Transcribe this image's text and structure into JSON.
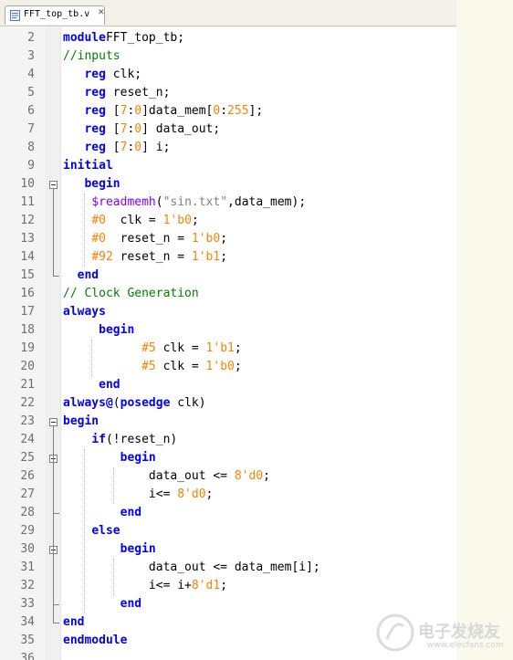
{
  "tab": {
    "filename": "FFT_top_tb.v",
    "close_label": "✕",
    "icon": "verilog-file-icon"
  },
  "colors": {
    "keyword": "#0000ff",
    "comment": "#008000",
    "number": "#ff8000",
    "system_task": "#8000ff",
    "string": "#808080",
    "line_number": "#6f6f6f"
  },
  "lines": [
    {
      "num": "2",
      "tokens": [
        [
          "kw2",
          "module"
        ],
        [
          "",
          "FFT_top_tb;"
        ]
      ]
    },
    {
      "num": "3",
      "tokens": [
        [
          "cmt",
          "//inputs"
        ]
      ]
    },
    {
      "num": "4",
      "tokens": [
        [
          "",
          "   "
        ],
        [
          "kw",
          "reg"
        ],
        [
          "",
          " clk;"
        ]
      ]
    },
    {
      "num": "5",
      "tokens": [
        [
          "",
          "   "
        ],
        [
          "kw",
          "reg"
        ],
        [
          "",
          " reset_n;"
        ]
      ]
    },
    {
      "num": "6",
      "tokens": [
        [
          "",
          "   "
        ],
        [
          "kw",
          "reg"
        ],
        [
          "",
          " ["
        ],
        [
          "num",
          "7"
        ],
        [
          "",
          ":"
        ],
        [
          "num",
          "0"
        ],
        [
          "",
          "]data_mem["
        ],
        [
          "num",
          "0"
        ],
        [
          "",
          ":"
        ],
        [
          "num",
          "255"
        ],
        [
          "",
          "];"
        ]
      ]
    },
    {
      "num": "7",
      "tokens": [
        [
          "",
          "   "
        ],
        [
          "kw",
          "reg"
        ],
        [
          "",
          " ["
        ],
        [
          "num",
          "7"
        ],
        [
          "",
          ":"
        ],
        [
          "num",
          "0"
        ],
        [
          "",
          "] data_out;"
        ]
      ]
    },
    {
      "num": "8",
      "tokens": [
        [
          "",
          "   "
        ],
        [
          "kw",
          "reg"
        ],
        [
          "",
          " ["
        ],
        [
          "num",
          "7"
        ],
        [
          "",
          ":"
        ],
        [
          "num",
          "0"
        ],
        [
          "",
          "] i;"
        ]
      ]
    },
    {
      "num": "9",
      "tokens": [
        [
          "kw",
          "initial"
        ]
      ]
    },
    {
      "num": "10",
      "tokens": [
        [
          "",
          "   "
        ],
        [
          "kw",
          "begin"
        ]
      ]
    },
    {
      "num": "11",
      "tokens": [
        [
          "",
          "    "
        ],
        [
          "task",
          "$readmemh"
        ],
        [
          "",
          "("
        ],
        [
          "str",
          "\"sin.txt\""
        ],
        [
          "",
          ",data_mem);"
        ]
      ]
    },
    {
      "num": "12",
      "tokens": [
        [
          "",
          "    "
        ],
        [
          "num",
          "#0"
        ],
        [
          "",
          "  clk = "
        ],
        [
          "num",
          "1'b0"
        ],
        [
          "",
          ";"
        ]
      ]
    },
    {
      "num": "13",
      "tokens": [
        [
          "",
          "    "
        ],
        [
          "num",
          "#0"
        ],
        [
          "",
          "  reset_n = "
        ],
        [
          "num",
          "1'b0"
        ],
        [
          "",
          ";"
        ]
      ]
    },
    {
      "num": "14",
      "tokens": [
        [
          "",
          "    "
        ],
        [
          "num",
          "#92"
        ],
        [
          "",
          " reset_n = "
        ],
        [
          "num",
          "1'b1"
        ],
        [
          "",
          ";"
        ]
      ]
    },
    {
      "num": "15",
      "tokens": [
        [
          "",
          "  "
        ],
        [
          "kw",
          "end"
        ]
      ]
    },
    {
      "num": "16",
      "tokens": [
        [
          "cmt",
          "// Clock Generation"
        ]
      ]
    },
    {
      "num": "17",
      "tokens": [
        [
          "kw",
          "always"
        ]
      ]
    },
    {
      "num": "18",
      "tokens": [
        [
          "",
          "     "
        ],
        [
          "kw",
          "begin"
        ]
      ]
    },
    {
      "num": "19",
      "tokens": [
        [
          "",
          "           "
        ],
        [
          "num",
          "#5"
        ],
        [
          "",
          " clk = "
        ],
        [
          "num",
          "1'b1"
        ],
        [
          "",
          ";"
        ]
      ]
    },
    {
      "num": "20",
      "tokens": [
        [
          "",
          "           "
        ],
        [
          "num",
          "#5"
        ],
        [
          "",
          " clk = "
        ],
        [
          "num",
          "1'b0"
        ],
        [
          "",
          ";"
        ]
      ]
    },
    {
      "num": "21",
      "tokens": [
        [
          "",
          "     "
        ],
        [
          "kw",
          "end"
        ]
      ]
    },
    {
      "num": "22",
      "tokens": [
        [
          "kw",
          "always@"
        ],
        [
          "",
          "("
        ],
        [
          "kw",
          "posedge"
        ],
        [
          "",
          " clk)"
        ]
      ]
    },
    {
      "num": "23",
      "tokens": [
        [
          "kw",
          "begin"
        ]
      ]
    },
    {
      "num": "24",
      "tokens": [
        [
          "",
          "    "
        ],
        [
          "kw",
          "if"
        ],
        [
          "",
          "(!reset_n)"
        ]
      ]
    },
    {
      "num": "25",
      "tokens": [
        [
          "",
          "        "
        ],
        [
          "kw",
          "begin"
        ]
      ]
    },
    {
      "num": "26",
      "tokens": [
        [
          "",
          "            data_out <= "
        ],
        [
          "num",
          "8'd0"
        ],
        [
          "",
          ";"
        ]
      ]
    },
    {
      "num": "27",
      "tokens": [
        [
          "",
          "            i<= "
        ],
        [
          "num",
          "8'd0"
        ],
        [
          "",
          ";"
        ]
      ]
    },
    {
      "num": "28",
      "tokens": [
        [
          "",
          "        "
        ],
        [
          "kw",
          "end"
        ]
      ]
    },
    {
      "num": "29",
      "tokens": [
        [
          "",
          "    "
        ],
        [
          "kw",
          "else"
        ]
      ]
    },
    {
      "num": "30",
      "tokens": [
        [
          "",
          "        "
        ],
        [
          "kw",
          "begin"
        ]
      ]
    },
    {
      "num": "31",
      "tokens": [
        [
          "",
          "            data_out <= data_mem[i];"
        ]
      ]
    },
    {
      "num": "32",
      "tokens": [
        [
          "",
          "            i<= i+"
        ],
        [
          "num",
          "8'd1"
        ],
        [
          "",
          ";"
        ]
      ]
    },
    {
      "num": "33",
      "tokens": [
        [
          "",
          "        "
        ],
        [
          "kw",
          "end"
        ]
      ]
    },
    {
      "num": "34",
      "tokens": [
        [
          "kw",
          "end"
        ]
      ]
    },
    {
      "num": "35",
      "tokens": [
        [
          "kw",
          "endmodule"
        ]
      ]
    },
    {
      "num": "36",
      "tokens": []
    }
  ],
  "fold_markers": [
    {
      "line": "10",
      "type": "open"
    },
    {
      "line": "15",
      "type": "close"
    },
    {
      "line": "23",
      "type": "open"
    },
    {
      "line": "25",
      "type": "open"
    },
    {
      "line": "28",
      "type": "close"
    },
    {
      "line": "30",
      "type": "open"
    },
    {
      "line": "33",
      "type": "close"
    },
    {
      "line": "34",
      "type": "close"
    }
  ],
  "watermark": {
    "logo": "elecfans-logo",
    "text": "电子发烧友",
    "url": "www.elecfans.com"
  }
}
